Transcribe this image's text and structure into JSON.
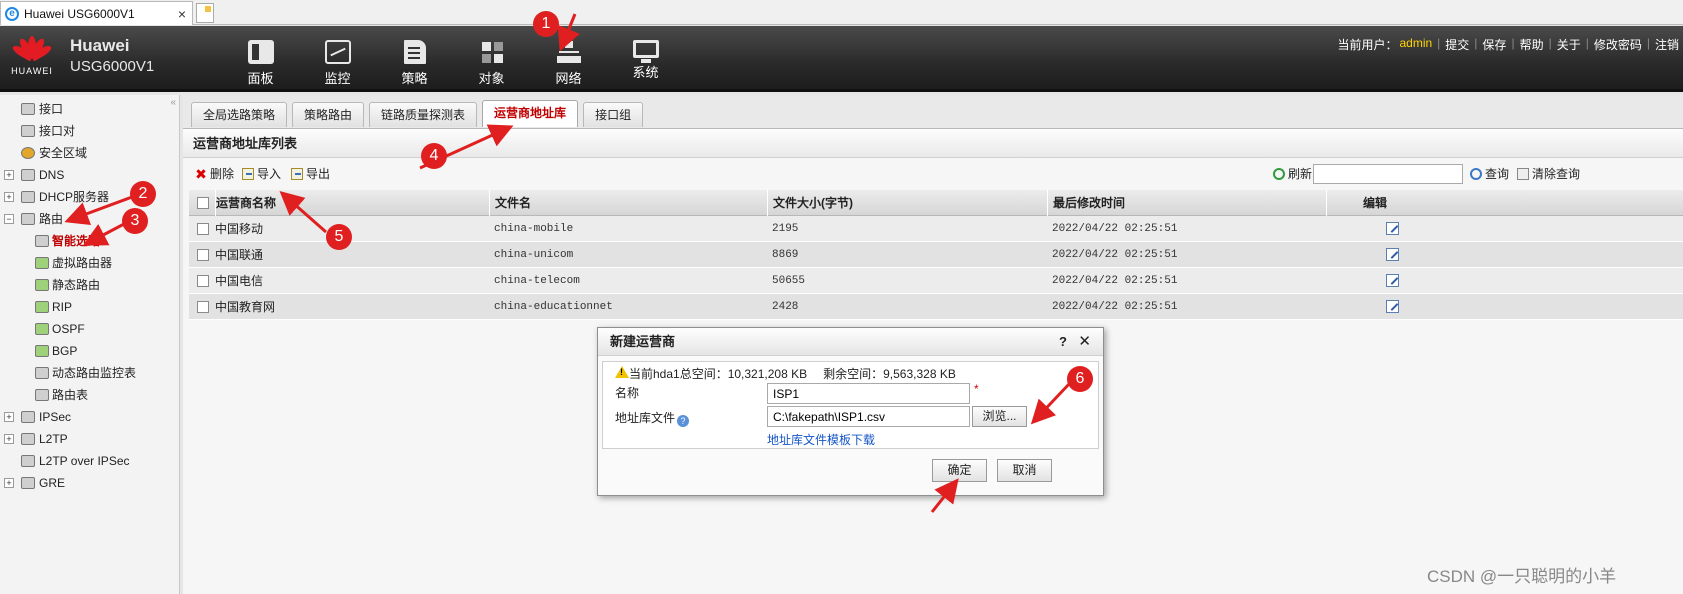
{
  "browser": {
    "tab_title": "Huawei USG6000V1",
    "close_glyph": "×"
  },
  "header": {
    "brand_text": "HUAWEI",
    "product_line1": "Huawei",
    "product_line2": "USG6000V1",
    "nav": [
      {
        "label": "面板",
        "icon": "panel-icon"
      },
      {
        "label": "监控",
        "icon": "monitor-icon"
      },
      {
        "label": "策略",
        "icon": "policy-icon"
      },
      {
        "label": "对象",
        "icon": "object-icon"
      },
      {
        "label": "网络",
        "icon": "network-icon"
      },
      {
        "label": "系统",
        "icon": "system-icon"
      }
    ],
    "current_user_label": "当前用户：",
    "user": "admin",
    "links": [
      "提交",
      "保存",
      "帮助",
      "关于",
      "修改密码",
      "注销"
    ]
  },
  "sidebar": {
    "collapse_glyph": "«",
    "items": [
      {
        "label": "接口"
      },
      {
        "label": "接口对"
      },
      {
        "label": "安全区域"
      },
      {
        "label": "DNS",
        "exp": "+"
      },
      {
        "label": "DHCP服务器",
        "exp": "+"
      },
      {
        "label": "路由",
        "exp": "−"
      },
      {
        "label": "智能选路"
      },
      {
        "label": "虚拟路由器"
      },
      {
        "label": "静态路由"
      },
      {
        "label": "RIP"
      },
      {
        "label": "OSPF"
      },
      {
        "label": "BGP"
      },
      {
        "label": "动态路由监控表"
      },
      {
        "label": "路由表"
      },
      {
        "label": "IPSec",
        "exp": "+"
      },
      {
        "label": "L2TP",
        "exp": "+"
      },
      {
        "label": "L2TP over IPSec"
      },
      {
        "label": "GRE",
        "exp": "+"
      }
    ]
  },
  "tabs": [
    "全局选路策略",
    "策略路由",
    "链路质量探测表",
    "运营商地址库",
    "接口组"
  ],
  "panel": {
    "title": "运营商地址库列表",
    "toolbar": {
      "delete": "删除",
      "import": "导入",
      "export": "导出",
      "refresh": "刷新",
      "query": "查询",
      "clear_query": "清除查询"
    },
    "search_value": "",
    "columns": [
      "运营商名称",
      "文件名",
      "文件大小(字节)",
      "最后修改时间",
      "编辑"
    ],
    "rows": [
      {
        "name": "中国移动",
        "file": "china-mobile",
        "size": "2195",
        "mtime": "2022/04/22 02:25:51"
      },
      {
        "name": "中国联通",
        "file": "china-unicom",
        "size": "8869",
        "mtime": "2022/04/22 02:25:51"
      },
      {
        "name": "中国电信",
        "file": "china-telecom",
        "size": "50655",
        "mtime": "2022/04/22 02:25:51"
      },
      {
        "name": "中国教育网",
        "file": "china-educationnet",
        "size": "2428",
        "mtime": "2022/04/22 02:25:51"
      }
    ]
  },
  "dialog": {
    "title": "新建运营商",
    "help_glyph": "?",
    "close_glyph": "✕",
    "total_space": "当前hda1总空间：10,321,208 KB",
    "free_space": "剩余空间：9,563,328 KB",
    "name_label": "名称",
    "name_value": "ISP1",
    "required_mark": "*",
    "file_label": "地址库文件",
    "help_mark": "?",
    "file_value": "C:\\fakepath\\ISP1.csv",
    "browse": "浏览...",
    "template_link": "地址库文件模板下载",
    "ok": "确定",
    "cancel": "取消"
  },
  "annotations": [
    "1",
    "2",
    "3",
    "4",
    "5",
    "6"
  ],
  "watermark": "CSDN @一只聪明的小羊",
  "colors": {
    "accent_red": "#c00000",
    "badge_red": "#e02020",
    "user_yellow": "#ffd400",
    "link_blue": "#1455c7"
  }
}
